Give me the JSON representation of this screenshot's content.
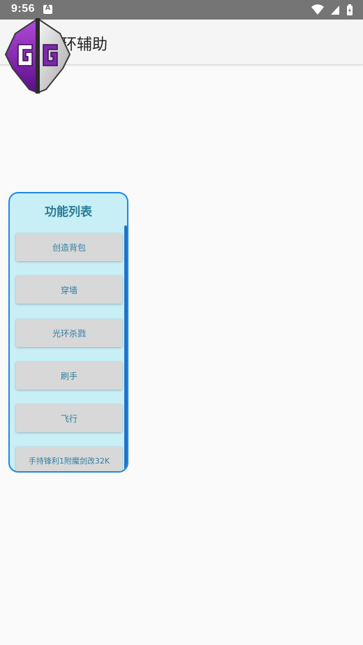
{
  "status_bar": {
    "time": "9:56",
    "notification_letter": "A"
  },
  "app_bar": {
    "title": "环辅助"
  },
  "floating_logo": {
    "letters": "GG"
  },
  "panel": {
    "title": "功能列表",
    "buttons": [
      {
        "label": "创造背包"
      },
      {
        "label": "穿墙"
      },
      {
        "label": "光环杀戮"
      },
      {
        "label": "刷手"
      },
      {
        "label": "飞行"
      },
      {
        "label": "手持锋利1附魔剑改32K"
      }
    ]
  },
  "colors": {
    "status_bar": "#757575",
    "panel_border": "#1e88e5",
    "panel_bg": "#c8eef6",
    "button_text": "#2f7fa0"
  }
}
